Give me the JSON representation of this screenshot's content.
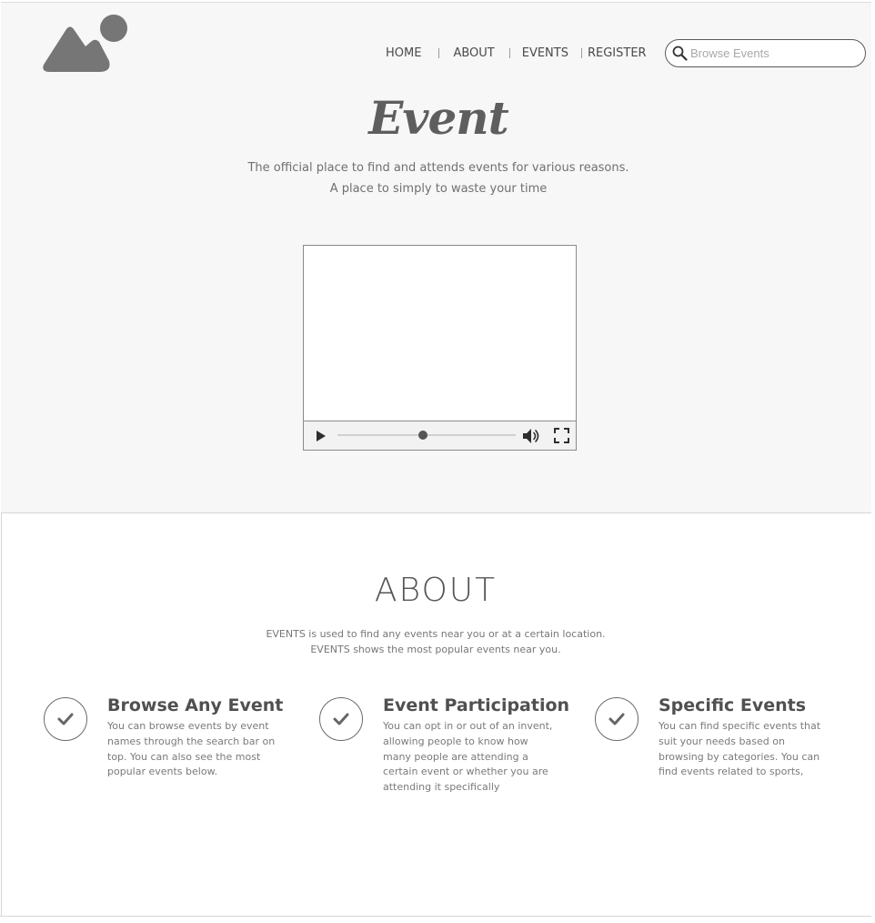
{
  "logo": {
    "icon": "mountain-sun-logo-icon"
  },
  "nav": {
    "items": [
      "HOME",
      "ABOUT",
      "EVENTS",
      "REGISTER"
    ]
  },
  "search": {
    "placeholder": "Browse Events",
    "icon": "search-icon"
  },
  "hero": {
    "brand": "Event",
    "tagline_1": "The official place to find and attends events for various reasons.",
    "tagline_2": "A place to simply to waste your time"
  },
  "video_player": {
    "progress": 0.48,
    "icons": [
      "play-icon",
      "volume-icon",
      "fullscreen-icon"
    ]
  },
  "about": {
    "title": "ABOUT",
    "description_1": "EVENTS is used to find any events near you or at a certain location.",
    "description_2": "EVENTS shows the most popular events near you.",
    "features": [
      {
        "title": "Browse Any Event",
        "text": "You can browse events by event names through the search bar on top. You can also see the most popular events below.",
        "icon": "checkmark-icon"
      },
      {
        "title": "Event Participation",
        "text": "You can opt in or out of an invent, allowing people to know how many people are attending a certain event or whether you are attending it specifically",
        "icon": "checkmark-icon"
      },
      {
        "title": "Specific Events",
        "text": "You can find specific events that suit your needs based on browsing by categories. You can find events related to sports,",
        "icon": "checkmark-icon"
      }
    ]
  },
  "colors": {
    "hero_background": "#f7f7f7",
    "text_dark": "#555555",
    "icon_gray": "#767676"
  }
}
